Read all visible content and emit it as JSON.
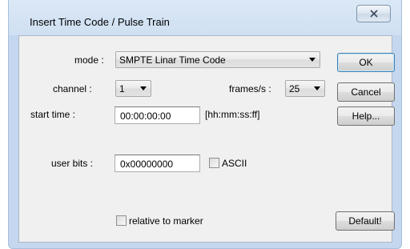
{
  "dialog": {
    "title": "Insert Time Code / Pulse Train",
    "close_glyph": "☒"
  },
  "form": {
    "mode_label": "mode :",
    "mode_value": "SMPTE Linar Time Code",
    "channel_label": "channel :",
    "channel_value": "1",
    "frames_label": "frames/s :",
    "frames_value": "25",
    "start_time_label": "start time :",
    "start_time_value": "00:00:00:00",
    "start_time_hint": "[hh:mm:ss:ff]",
    "user_bits_label": "user bits :",
    "user_bits_value": "0x00000000",
    "ascii_label": "ASCII",
    "ascii_checked": false,
    "relative_label": "relative to marker",
    "relative_checked": false
  },
  "buttons": {
    "ok": "OK",
    "cancel": "Cancel",
    "help": "Help...",
    "default": "Default!"
  }
}
